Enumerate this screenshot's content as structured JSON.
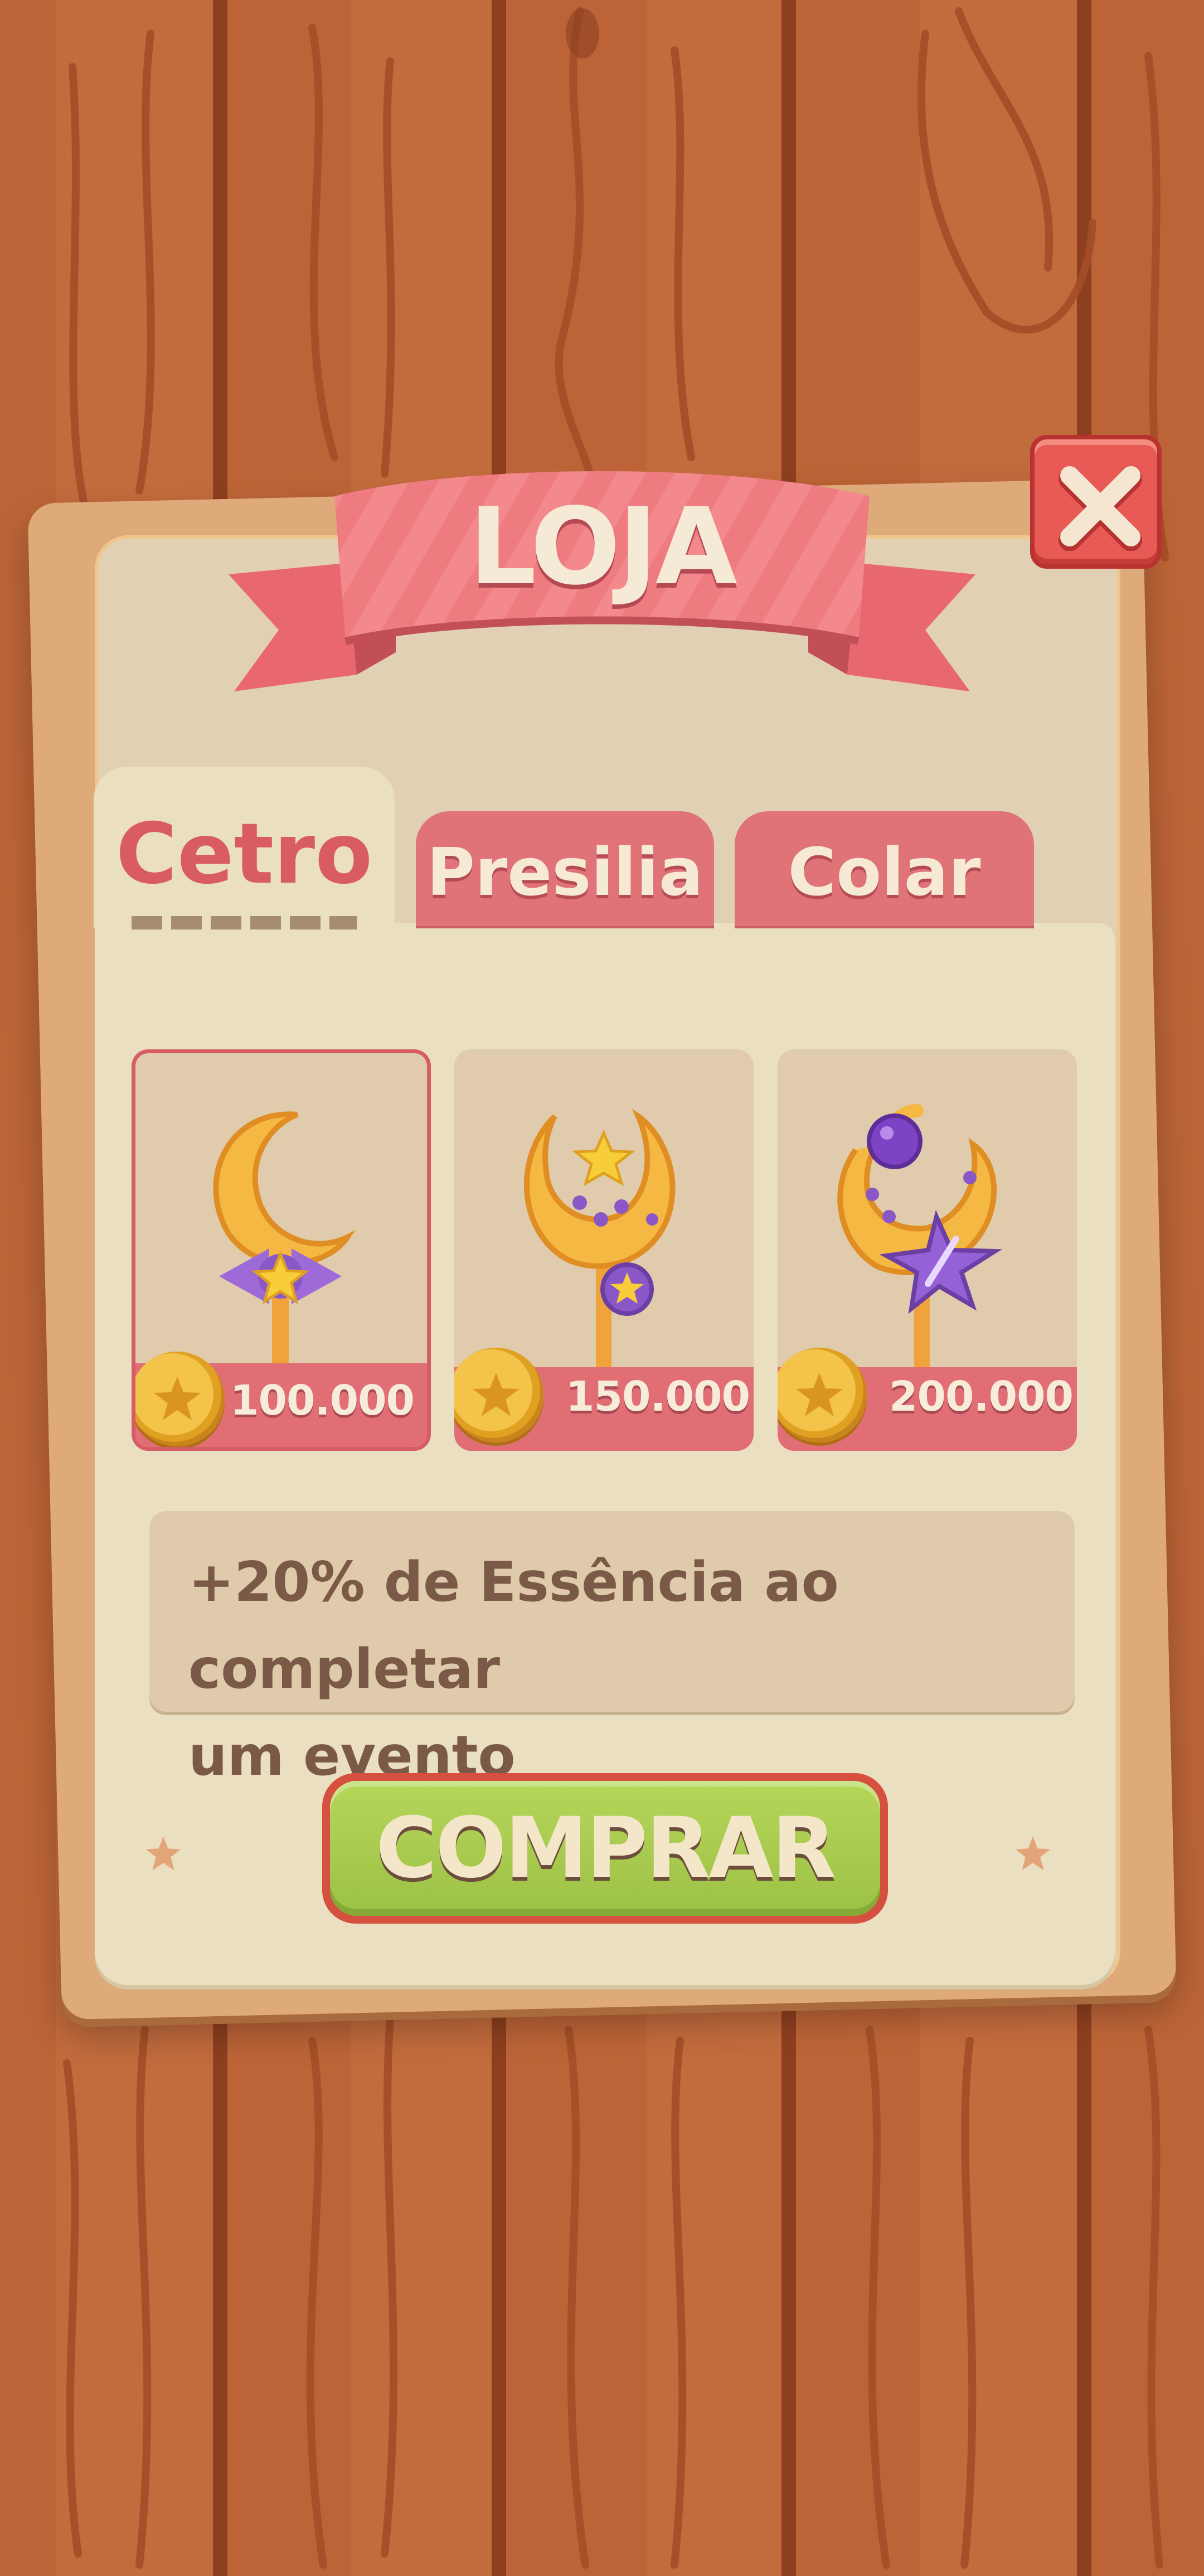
{
  "header": {
    "title": "LOJA"
  },
  "tabs": [
    {
      "label": "Cetro",
      "active": true
    },
    {
      "label": "Presilia",
      "active": false
    },
    {
      "label": "Colar",
      "active": false
    }
  ],
  "items": [
    {
      "icon": "moon-scepter-bow-icon",
      "price": "100.000",
      "selected": true
    },
    {
      "icon": "moon-scepter-star-icon",
      "price": "150.000",
      "selected": false
    },
    {
      "icon": "moon-scepter-crystal-icon",
      "price": "200.000",
      "selected": false
    }
  ],
  "description": {
    "line1": "+20% de Essência ao completar",
    "line2": "um evento"
  },
  "buy_button": {
    "label": "COMPRAR"
  },
  "colors": {
    "accent": "#e06e74",
    "buy": "#9cc145",
    "close": "#e85a56",
    "wood": "#b9663a"
  }
}
